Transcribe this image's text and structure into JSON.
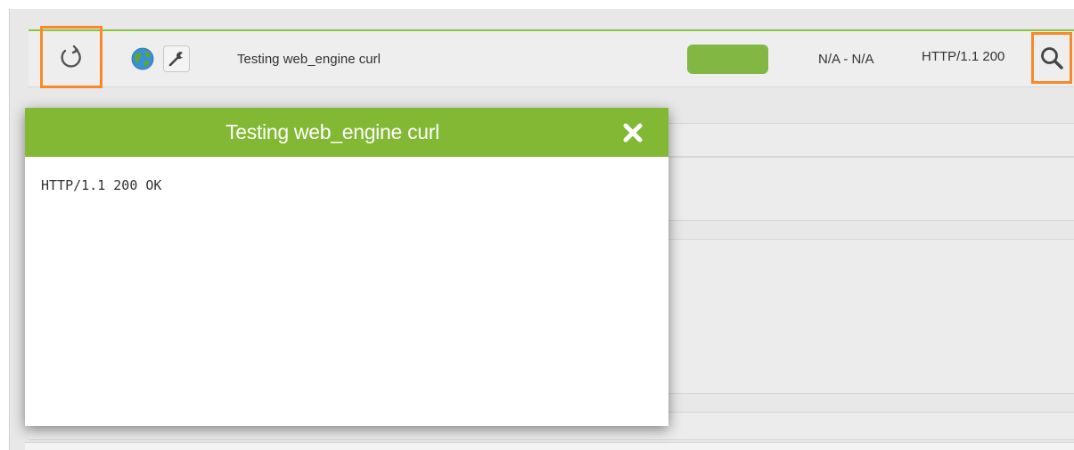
{
  "module": {
    "name": "Testing web_engine curl",
    "interval": "N/A - N/A",
    "data": "HTTP/1.1 200",
    "status_color": "#82b743",
    "icons": {
      "refresh": "refresh-icon",
      "type": "globe-icon",
      "config": "wrench-icon",
      "details": "magnifier-icon"
    }
  },
  "modal": {
    "title": "Testing web_engine curl",
    "body": "HTTP/1.1 200 OK",
    "close_icon": "close-icon",
    "header_color": "#82b833"
  },
  "highlight_color": "#f7892a"
}
